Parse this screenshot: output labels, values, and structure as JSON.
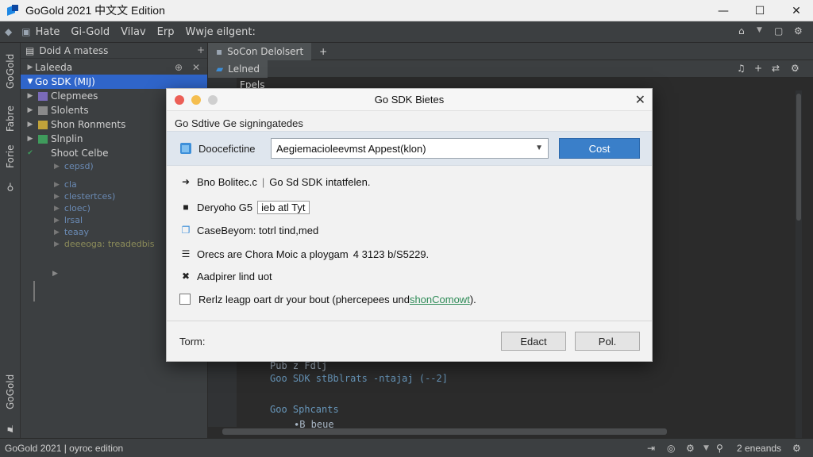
{
  "app": {
    "title": "GoGold 2021 中文文 Edition"
  },
  "window_controls": {
    "minimize": "—",
    "maximize": "☐",
    "close": "✕"
  },
  "menu": {
    "items": [
      "Hate",
      "Gi-Gold",
      "Vilav",
      "Erp",
      "Wwje eilgent:"
    ]
  },
  "left_strip": {
    "tabs": [
      "GoGold",
      "Fabre",
      "Forie",
      "GoGold"
    ]
  },
  "project": {
    "header": "Doid A matess",
    "root": "Laleeda",
    "selected": "Go SDK (MIJ)",
    "items": [
      "Clepmees",
      "Slolents",
      "Shon Ronments",
      "Slnplin",
      "Shoot Celbe"
    ],
    "subitems": [
      "cepsd)",
      "cla",
      "clestertces)",
      "cloec)",
      "lrsal",
      "teaay",
      "deeeoga: treadedbis"
    ]
  },
  "editor": {
    "tab_top": "SoCon Delolsert",
    "tab_second": "Lelned",
    "tab_third": "Fpels",
    "code_lines": [
      "Pub z Fdlj",
      "Goo SDK stBblrats -ntajaj (--2]",
      "Goo Sphcants",
      "∙B beue"
    ]
  },
  "statusbar": {
    "left": "GoGold 2021 | oyroc edition",
    "right": "2 eneands"
  },
  "dialog": {
    "title": "Go SDK Bietes",
    "subtitle": "Go Sdtive Ge signingatedes",
    "sdk_label": "Doocefictine",
    "sdk_value": "Aegiemacioleevmst Appest(klon)",
    "primary_button": "Cost",
    "items": [
      {
        "icon": "arrow",
        "text": "Bno Bolitec.c",
        "extra": "Go Sd SDK intatfelen."
      },
      {
        "icon": "folder",
        "text": "Deryoho G5",
        "extra": "ieb atl Tyt"
      },
      {
        "icon": "copy",
        "text": "CaseBeyom: totrl tind,med"
      },
      {
        "icon": "list",
        "text": "Orecs are Chora Moic a ploygam",
        "extra": "4 3123 b/S5229."
      },
      {
        "icon": "tools",
        "text": "Aadpirer lind uot"
      }
    ],
    "checkbox_text": "Rerlz leagp oart dr your bout (phercepees und ",
    "checkbox_link": "shonComowt",
    "checkbox_end": ").",
    "footer_label": "Torm:",
    "button_left": "Edact",
    "button_right": "Pol."
  },
  "colors": {
    "accent": "#3a7fc9",
    "selection": "#2f65ca",
    "traffic_red": "#ec5f57",
    "traffic_yellow": "#f5be4f",
    "traffic_gray": "#cfcfcf"
  }
}
